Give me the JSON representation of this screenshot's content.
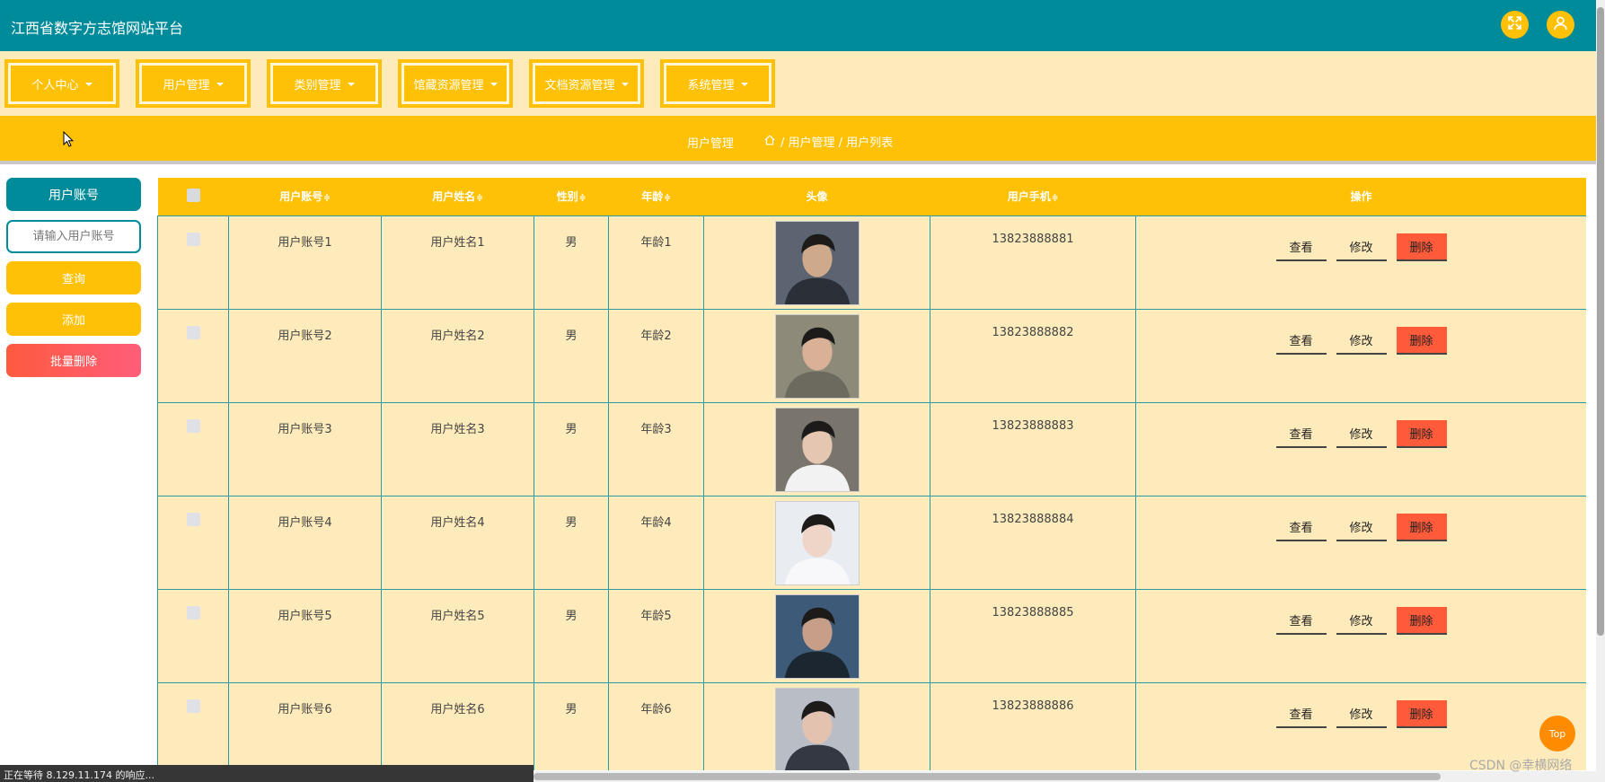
{
  "app": {
    "title": "江西省数字方志馆网站平台"
  },
  "header_icons": [
    "fullscreen-icon",
    "user-icon"
  ],
  "nav": {
    "items": [
      {
        "label": "个人中心"
      },
      {
        "label": "用户管理"
      },
      {
        "label": "类别管理"
      },
      {
        "label": "馆藏资源管理"
      },
      {
        "label": "文档资源管理"
      },
      {
        "label": "系统管理"
      }
    ]
  },
  "breadcrumb": {
    "current": "用户管理",
    "trail": "/ 用户管理 / 用户列表"
  },
  "search": {
    "label": "用户账号",
    "placeholder": "请输入用户账号",
    "query_label": "查询",
    "add_label": "添加",
    "batch_delete_label": "批量删除"
  },
  "table": {
    "columns": [
      "用户账号",
      "用户姓名",
      "性别",
      "年龄",
      "头像",
      "用户手机",
      "操作"
    ],
    "sort_mark": "≑",
    "rows": [
      {
        "account": "用户账号1",
        "name": "用户姓名1",
        "gender": "男",
        "age": "年龄1",
        "phone": "13823888881"
      },
      {
        "account": "用户账号2",
        "name": "用户姓名2",
        "gender": "男",
        "age": "年龄2",
        "phone": "13823888882"
      },
      {
        "account": "用户账号3",
        "name": "用户姓名3",
        "gender": "男",
        "age": "年龄3",
        "phone": "13823888883"
      },
      {
        "account": "用户账号4",
        "name": "用户姓名4",
        "gender": "男",
        "age": "年龄4",
        "phone": "13823888884"
      },
      {
        "account": "用户账号5",
        "name": "用户姓名5",
        "gender": "男",
        "age": "年龄5",
        "phone": "13823888885"
      },
      {
        "account": "用户账号6",
        "name": "用户姓名6",
        "gender": "男",
        "age": "年龄6",
        "phone": "13823888886"
      }
    ],
    "actions": {
      "view": "查看",
      "edit": "修改",
      "delete": "删除"
    }
  },
  "status_bar": "正在等待 8.129.11.174 的响应...",
  "top_button": "Top",
  "watermark": "CSDN @幸横网络",
  "colors": {
    "primary": "#008b9a",
    "accent": "#ffc106",
    "background": "#feebbb",
    "danger": "#ff5a3a"
  }
}
